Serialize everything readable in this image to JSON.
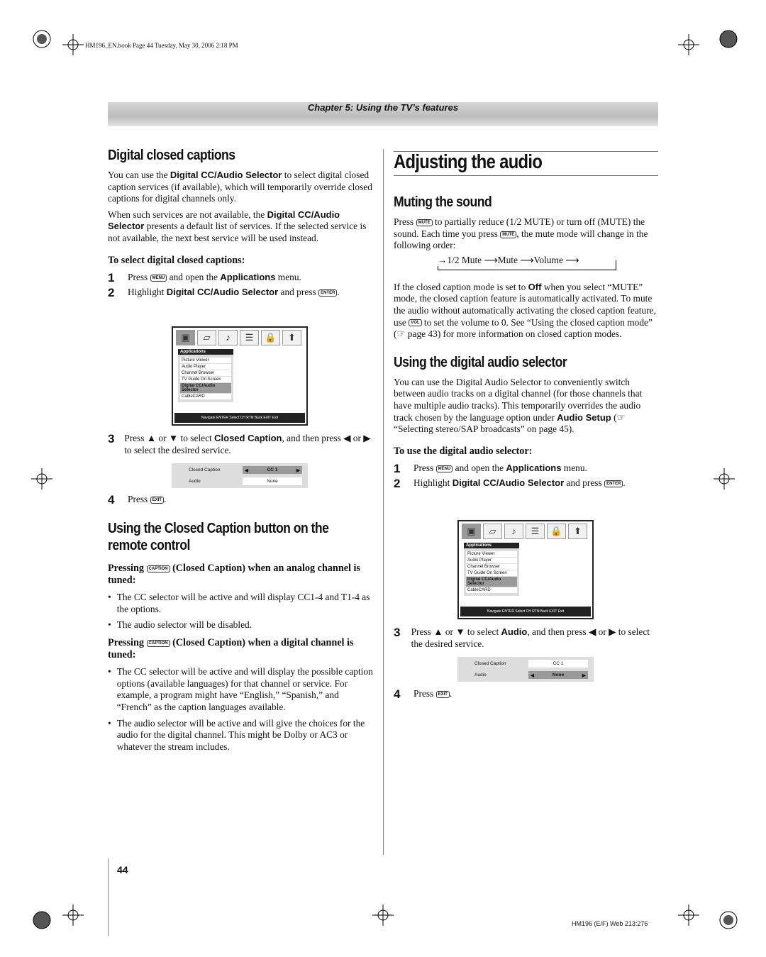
{
  "print_header": "HM196_EN.book  Page 44  Tuesday, May 30, 2006  2:18 PM",
  "chapter": "Chapter 5: Using the TV’s features",
  "left": {
    "title": "Digital closed captions",
    "p1_a": "You can use the ",
    "p1_b": "Digital CC/Audio Selector",
    "p1_c": " to select digital closed caption services (if available), which will temporarily override closed captions for digital channels only.",
    "p2_a": "When such services are not available, the ",
    "p2_b": "Digital CC/Audio Selector",
    "p2_c": " presents a default list of services. If the selected service is not available, the next best service will be used instead.",
    "sub": "To select digital closed captions:",
    "steps": [
      {
        "n": "1",
        "a": "Press ",
        "key": "MENU",
        "b": " and open the ",
        "bold": "Applications",
        "c": " menu."
      },
      {
        "n": "2",
        "a": "Highlight ",
        "bold": "Digital CC/Audio Selector",
        "b": " and press ",
        "key": "ENTER",
        "c": "."
      },
      {
        "n": "3",
        "a": "Press ▲ or ▼ to select ",
        "bold": "Closed Caption",
        "b": ", and then press ◀ or ▶ to select the desired service."
      },
      {
        "n": "4",
        "a": "Press ",
        "key": "EXIT",
        "b": "."
      }
    ],
    "title2": "Using the Closed Caption button on the remote control",
    "h_analog_a": "Pressing ",
    "h_analog_key": "CAPTION",
    "h_analog_b": " (Closed Caption) when an analog channel is tuned:",
    "analog_bullets": [
      "The CC selector will be active and will display CC1-4 and T1-4 as the options.",
      "The audio selector will be disabled."
    ],
    "h_digital_a": "Pressing ",
    "h_digital_key": "CAPTION",
    "h_digital_b": " (Closed Caption) when a digital channel is tuned:",
    "digital_bullets": [
      "The CC selector will be active and will display the possible caption options (available languages) for that channel or service. For example, a program might have “English,” “Spanish,” and “French” as the caption languages available.",
      "The audio selector will be active and will give the choices for the audio for the digital channel. This might be Dolby or AC3 or whatever the stream includes."
    ]
  },
  "menu": {
    "title": "Applications",
    "items": [
      "Picture Viewer",
      "Audio Player",
      "Channel Browser",
      "TV Guide On Screen",
      "Digital CC/Audio Selector",
      "CableCARD"
    ],
    "footer": "Navigate  ENTER Select  CH RTN Back  EXIT Exit"
  },
  "cc_left": {
    "row1_label": "Closed Caption",
    "row1_value": "CC 1",
    "row2_label": "Audio",
    "row2_value": "None"
  },
  "cc_right": {
    "row1_label": "Closed Caption",
    "row1_value": "CC 1",
    "row2_label": "Audio",
    "row2_value": "None"
  },
  "right": {
    "title": "Adjusting the audio",
    "sub1": "Muting the sound",
    "mute_p_a": "Press ",
    "mute_key": "MUTE",
    "mute_p_b": " to partially reduce (1/2 MUTE) or turn off (MUTE) the sound. Each time you press ",
    "mute_p_c": ", the mute mode will change in the following order:",
    "cycle": [
      "1/2 Mute",
      "Mute",
      "Volume"
    ],
    "cc_p_a": "If the closed caption mode is set to ",
    "cc_p_bold": "Off",
    "cc_p_b": " when you select “MUTE” mode, the closed caption feature is automatically activated. To mute the audio without automatically activating the closed caption feature, use ",
    "vol_key": "VOL",
    "cc_p_c": " to set the volume to 0. See “Using the closed caption mode” (☞ page 43) for more information on closed caption modes.",
    "sub2": "Using the digital audio selector",
    "das_a": "You can use the Digital Audio Selector to conveniently switch between audio tracks on a digital channel (for those channels that have multiple audio tracks). This temporarily overrides the audio track chosen by the language option under ",
    "das_bold": "Audio Setup",
    "das_b": " (☞ “Selecting stereo/SAP broadcasts” on page 45).",
    "sub3": "To use the digital audio selector:",
    "steps": [
      {
        "n": "1",
        "a": "Press ",
        "key": "MENU",
        "b": " and open the ",
        "bold": "Applications",
        "c": " menu."
      },
      {
        "n": "2",
        "a": "Highlight ",
        "bold": "Digital CC/Audio Selector",
        "b": " and press ",
        "key": "ENTER",
        "c": "."
      },
      {
        "n": "3",
        "a": "Press ▲ or ▼ to select ",
        "bold": "Audio",
        "b": ", and then press ◀ or ▶ to select the desired service."
      },
      {
        "n": "4",
        "a": "Press ",
        "key": "EXIT",
        "b": "."
      }
    ]
  },
  "page_number": "44",
  "footer_code": "HM196 (E/F) Web 213:276"
}
